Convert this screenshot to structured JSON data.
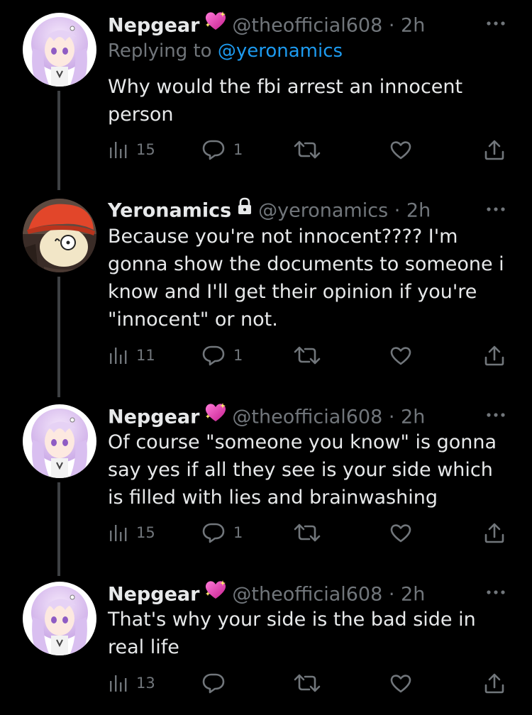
{
  "tweets": [
    {
      "name": "Nepgear",
      "handle": "@theofficial608",
      "time": "· 2h",
      "replying_prefix": "Replying to",
      "replying_handle": "@yeronamics",
      "text": "Why would the fbi arrest an innocent person",
      "views": "15",
      "replies": "1"
    },
    {
      "name": "Yeronamics",
      "handle": "@yeronamics",
      "time": "· 2h",
      "text": "Because you're not innocent???? I'm gonna show the documents to someone i know and I'll get their opinion if you're \"innocent\" or not.",
      "views": "11",
      "replies": "1"
    },
    {
      "name": "Nepgear",
      "handle": "@theofficial608",
      "time": "· 2h",
      "text": "Of course \"someone you know\" is gonna say yes if all they see is your side which is filled with lies and brainwashing",
      "views": "15",
      "replies": "1"
    },
    {
      "name": "Nepgear",
      "handle": "@theofficial608",
      "time": "· 2h",
      "text": "That's why your side is the bad side in real life",
      "views": "13",
      "replies": ""
    }
  ],
  "icons": {
    "views": "bar-chart-icon",
    "reply": "speech-bubble-icon",
    "retweet": "retweet-icon",
    "like": "heart-icon",
    "share": "share-icon",
    "more": "more-dots-icon",
    "badge": "sparkling-heart-icon",
    "protected": "lock-icon"
  },
  "colors": {
    "background": "#000000",
    "text": "#e7e9ea",
    "muted": "#71767b",
    "link": "#1d9bf0"
  }
}
